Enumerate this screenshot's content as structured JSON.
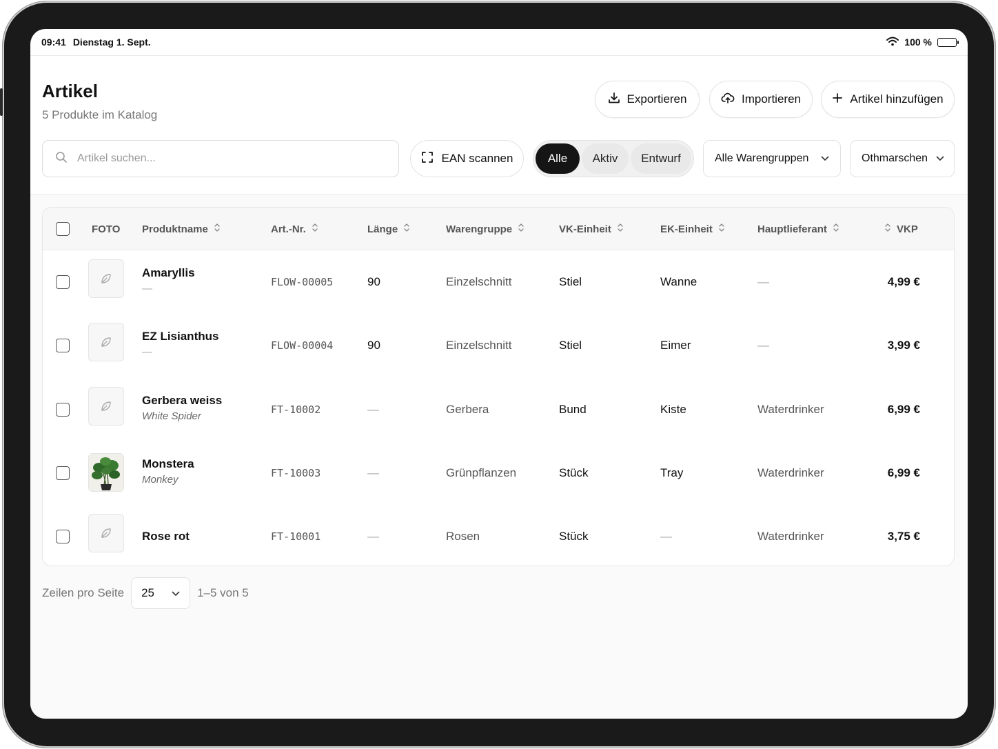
{
  "status": {
    "time": "09:41",
    "date": "Dienstag 1. Sept.",
    "battery": "100 %"
  },
  "header": {
    "title": "Artikel",
    "subtitle": "5 Produkte im Katalog"
  },
  "actions": {
    "export": "Exportieren",
    "import": "Importieren",
    "add": "Artikel hinzufügen"
  },
  "search": {
    "placeholder": "Artikel suchen..."
  },
  "scan": {
    "label": "EAN scannen"
  },
  "filters": {
    "all": "Alle",
    "active": "Aktiv",
    "draft": "Entwurf",
    "selected": "Alle"
  },
  "groups_dropdown": {
    "value": "Alle Warengruppen"
  },
  "location_dropdown": {
    "value": "Othmarschen"
  },
  "table": {
    "headers": {
      "photo": "FOTO",
      "name": "Produktname",
      "art": "Art.-Nr.",
      "length": "Länge",
      "group": "Warengruppe",
      "vk": "VK-Einheit",
      "ek": "EK-Einheit",
      "supplier": "Hauptlieferant",
      "price": "VKP"
    },
    "rows": [
      {
        "name": "Amaryllis",
        "sub": "—",
        "art": "FLOW-00005",
        "length": "90",
        "group": "Einzelschnitt",
        "vk": "Stiel",
        "ek": "Wanne",
        "supplier": "—",
        "price": "4,99 €",
        "photo": "leaf-placeholder-icon"
      },
      {
        "name": "EZ Lisianthus",
        "sub": "—",
        "art": "FLOW-00004",
        "length": "90",
        "group": "Einzelschnitt",
        "vk": "Stiel",
        "ek": "Eimer",
        "supplier": "—",
        "price": "3,99 €",
        "photo": "leaf-placeholder-icon"
      },
      {
        "name": "Gerbera weiss",
        "sub": "White Spider",
        "art": "FT-10002",
        "length": "—",
        "group": "Gerbera",
        "vk": "Bund",
        "ek": "Kiste",
        "supplier": "Waterdrinker",
        "price": "6,99 €",
        "photo": "leaf-placeholder-icon"
      },
      {
        "name": "Monstera",
        "sub": "Monkey",
        "art": "FT-10003",
        "length": "—",
        "group": "Grünpflanzen",
        "vk": "Stück",
        "ek": "Tray",
        "supplier": "Waterdrinker",
        "price": "6,99 €",
        "photo": "monstera-plant-photo"
      },
      {
        "name": "Rose rot",
        "sub": "",
        "art": "FT-10001",
        "length": "—",
        "group": "Rosen",
        "vk": "Stück",
        "ek": "—",
        "supplier": "Waterdrinker",
        "price": "3,75 €",
        "photo": "leaf-placeholder-icon"
      }
    ]
  },
  "pagination": {
    "rows_label": "Zeilen pro Seite",
    "per_page": "25",
    "range": "1–5 von 5"
  }
}
